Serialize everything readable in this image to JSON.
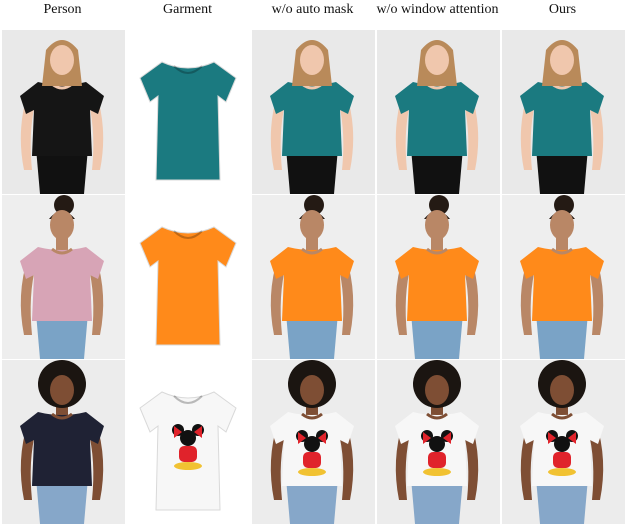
{
  "columns": [
    "Person",
    "Garment",
    "w/o auto mask",
    "w/o window attention",
    "Ours"
  ],
  "rows": [
    {
      "id": "row-1",
      "skin": "#f0c7ad",
      "hair": "#b98a5a",
      "hair_style": "long",
      "person_top": "#151515",
      "garment": "#1b7a80",
      "bottom": "#111111",
      "garment_bg": "#ffffff",
      "cell_bg": "#e9e9e9",
      "print": "none"
    },
    {
      "id": "row-2",
      "skin": "#b98766",
      "hair": "#241a14",
      "hair_style": "bun",
      "person_top": "#d7a4b6",
      "garment": "#ff8a1a",
      "bottom": "#7aa3c6",
      "garment_bg": "#ffffff",
      "cell_bg": "#eeeeee",
      "print": "none"
    },
    {
      "id": "row-3",
      "skin": "#7e4e34",
      "hair": "#1b1511",
      "hair_style": "afro",
      "person_top": "#1f2234",
      "garment": "#f7f7f7",
      "bottom": "#86a7c9",
      "garment_bg": "#ffffff",
      "cell_bg": "#ececec",
      "print": "cartoon-mouse"
    }
  ]
}
